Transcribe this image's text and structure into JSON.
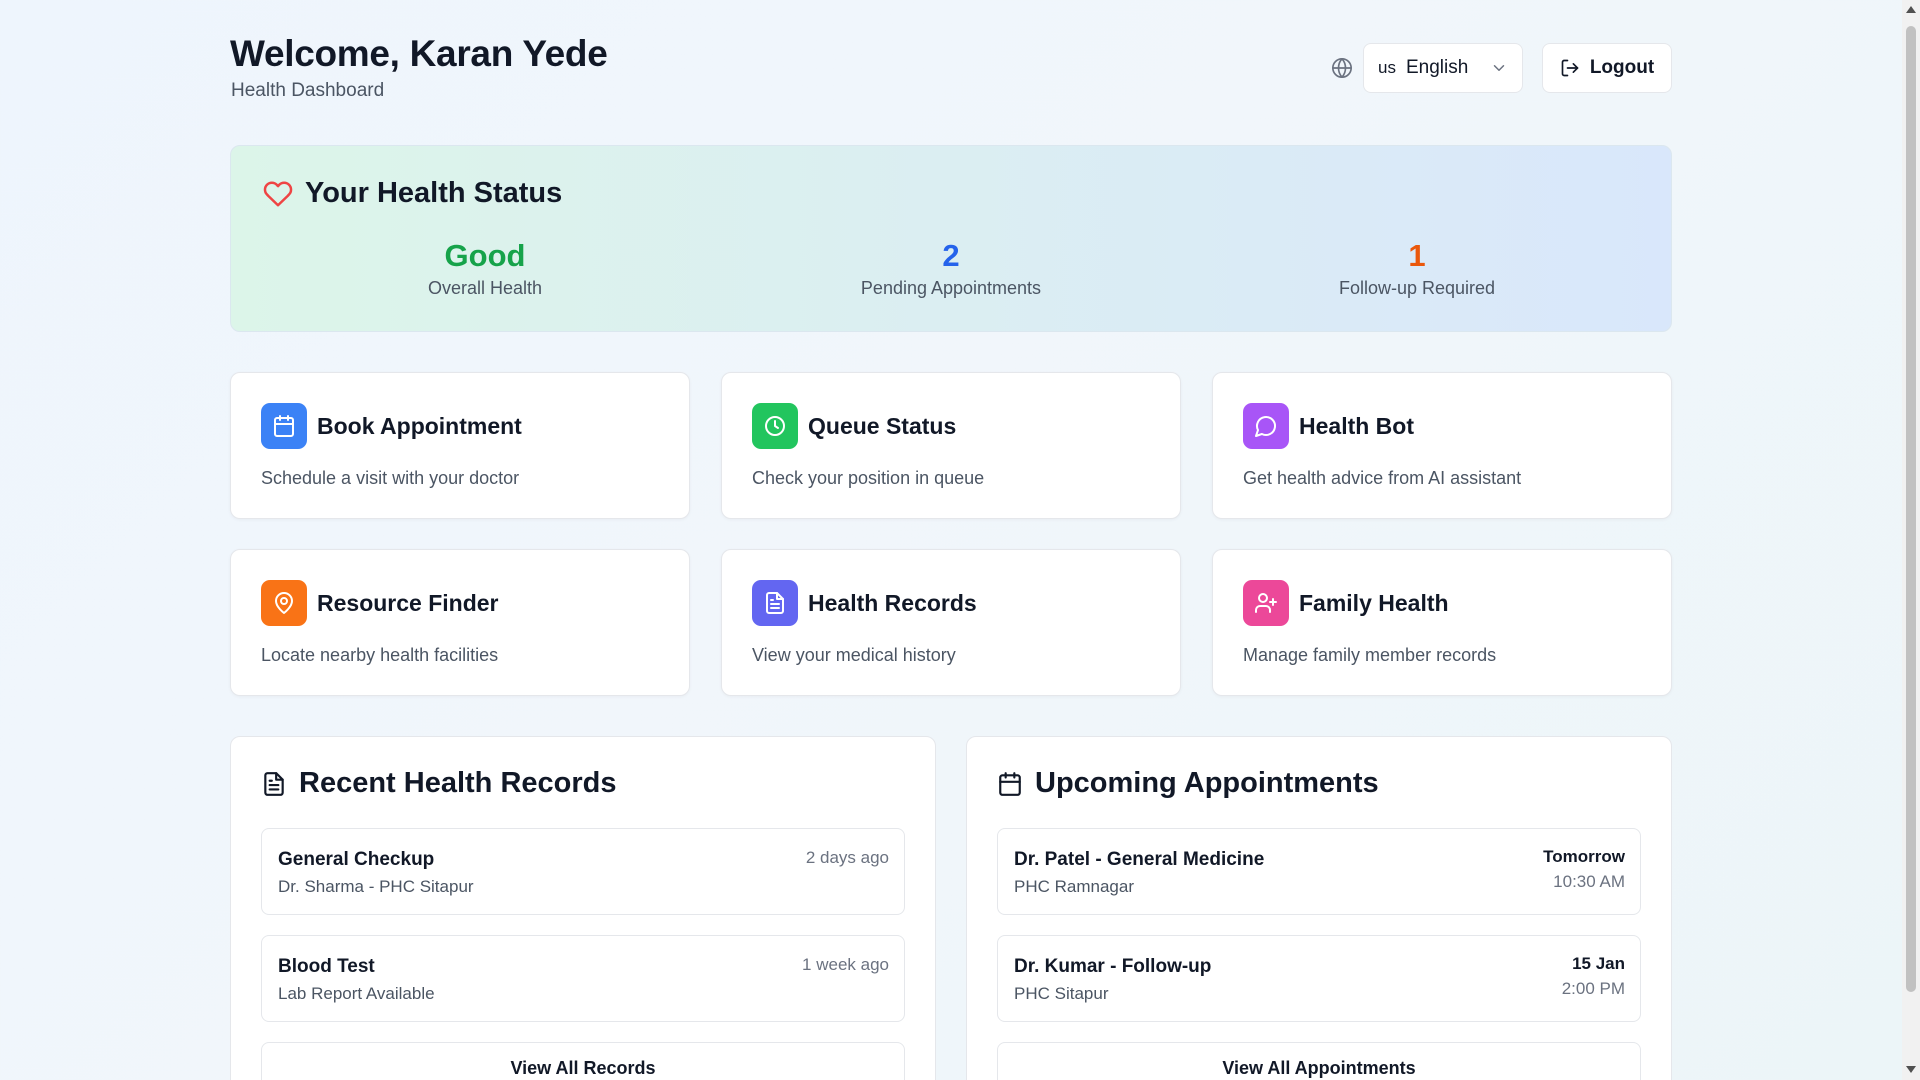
{
  "header": {
    "welcome": "Welcome, Karan Yede",
    "subtitle": "Health Dashboard",
    "language": {
      "flag": "us",
      "selected": "English"
    },
    "logout_label": "Logout"
  },
  "health_status": {
    "title": "Your Health Status",
    "stats": [
      {
        "value": "Good",
        "label": "Overall Health",
        "color": "#16a34a"
      },
      {
        "value": "2",
        "label": "Pending Appointments",
        "color": "#2563eb"
      },
      {
        "value": "1",
        "label": "Follow-up Required",
        "color": "#ea580c"
      }
    ]
  },
  "actions": [
    {
      "title": "Book Appointment",
      "description": "Schedule a visit with your doctor",
      "icon": "calendar-icon",
      "color": "#3b82f6"
    },
    {
      "title": "Queue Status",
      "description": "Check your position in queue",
      "icon": "clock-icon",
      "color": "#22c55e"
    },
    {
      "title": "Health Bot",
      "description": "Get health advice from AI assistant",
      "icon": "chat-icon",
      "color": "#a855f7"
    },
    {
      "title": "Resource Finder",
      "description": "Locate nearby health facilities",
      "icon": "map-pin-icon",
      "color": "#f97316"
    },
    {
      "title": "Health Records",
      "description": "View your medical history",
      "icon": "file-text-icon",
      "color": "#6366f1"
    },
    {
      "title": "Family Health",
      "description": "Manage family member records",
      "icon": "user-plus-icon",
      "color": "#ec4899"
    }
  ],
  "recent_records": {
    "title": "Recent Health Records",
    "items": [
      {
        "name": "General Checkup",
        "detail": "Dr. Sharma - PHC Sitapur",
        "when": "2 days ago"
      },
      {
        "name": "Blood Test",
        "detail": "Lab Report Available",
        "when": "1 week ago"
      }
    ],
    "view_all_label": "View All Records"
  },
  "upcoming_appointments": {
    "title": "Upcoming Appointments",
    "items": [
      {
        "name": "Dr. Patel - General Medicine",
        "detail": "PHC Ramnagar",
        "date": "Tomorrow",
        "time": "10:30 AM"
      },
      {
        "name": "Dr. Kumar - Follow-up",
        "detail": "PHC Sitapur",
        "date": "15 Jan",
        "time": "2:00 PM"
      }
    ],
    "view_all_label": "View All Appointments"
  }
}
